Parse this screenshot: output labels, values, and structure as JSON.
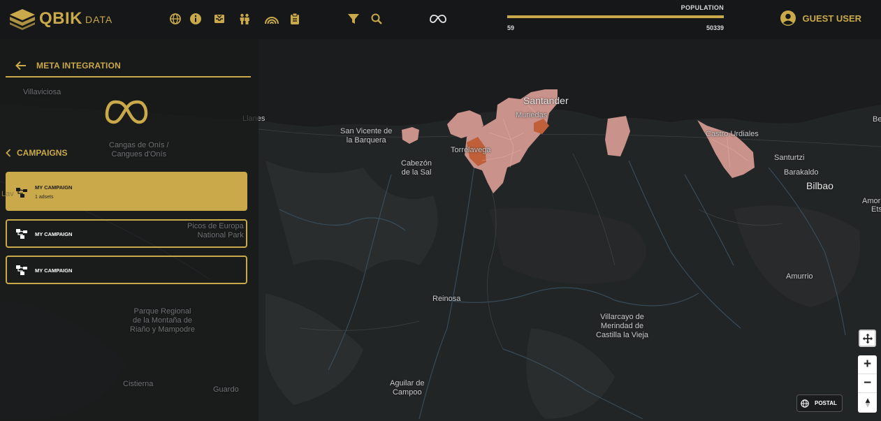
{
  "app": {
    "brand": "QBIK",
    "brand_sub": "DATA"
  },
  "toolbar": {
    "icons": [
      "globe-icon",
      "info-icon",
      "inbox-icon",
      "people-icon",
      "rainbow-icon",
      "clipboard-icon",
      "filter-icon",
      "search-icon",
      "meta-icon"
    ]
  },
  "population": {
    "title": "POPULATION",
    "min": "59",
    "max": "50339",
    "fill_fraction": 1.0
  },
  "user": {
    "label": "GUEST USER"
  },
  "sidebar": {
    "back_title": "META INTEGRATION",
    "campaigns_label": "CAMPAIGNS",
    "campaigns": [
      {
        "name": "MY CAMPAIGN",
        "sub": "1 adsets",
        "active": true
      },
      {
        "name": "MY CAMPAIGN",
        "sub": "",
        "active": false
      },
      {
        "name": "MY CAMPAIGN",
        "sub": "",
        "active": false
      }
    ]
  },
  "map": {
    "labels": {
      "santander": "Santander",
      "muriedas": "Muriedas",
      "torrelavega": "Torrelavega",
      "san_vicente": "San Vicente de\nla Barquera",
      "cabezon": "Cabezón\nde la Sal",
      "llanes": "Llanes",
      "villaviciosa": "Villaviciosa",
      "cangas": "Cangas de Onís /\nCangues d'Onís",
      "picos": "Picos de Europa\nNational Park",
      "parque": "Parque Regional\nde la Montaña de\nRiaño y Mampodre",
      "cistierna": "Cistierna",
      "guardo": "Guardo",
      "reinosa": "Reinosa",
      "aguilar": "Aguilar de\nCampoo",
      "villarcayo": "Villarcayo de\nMerindad de\nCastilla la Vieja",
      "castro": "Castro Urdiales",
      "santurtzi": "Santurtzi",
      "barakaldo": "Barakaldo",
      "bilbao": "Bilbao",
      "amurrio": "Amurrio",
      "amor": "Amor",
      "ets": "Ets",
      "be": "Be",
      "lav": "Lav"
    },
    "controls": {
      "zoom_in": "+",
      "zoom_out": "−",
      "postal_label": "POSTAL"
    }
  },
  "colors": {
    "accent": "#c9a94a",
    "region_light": "#c9928a",
    "region_dark": "#c0603a"
  }
}
